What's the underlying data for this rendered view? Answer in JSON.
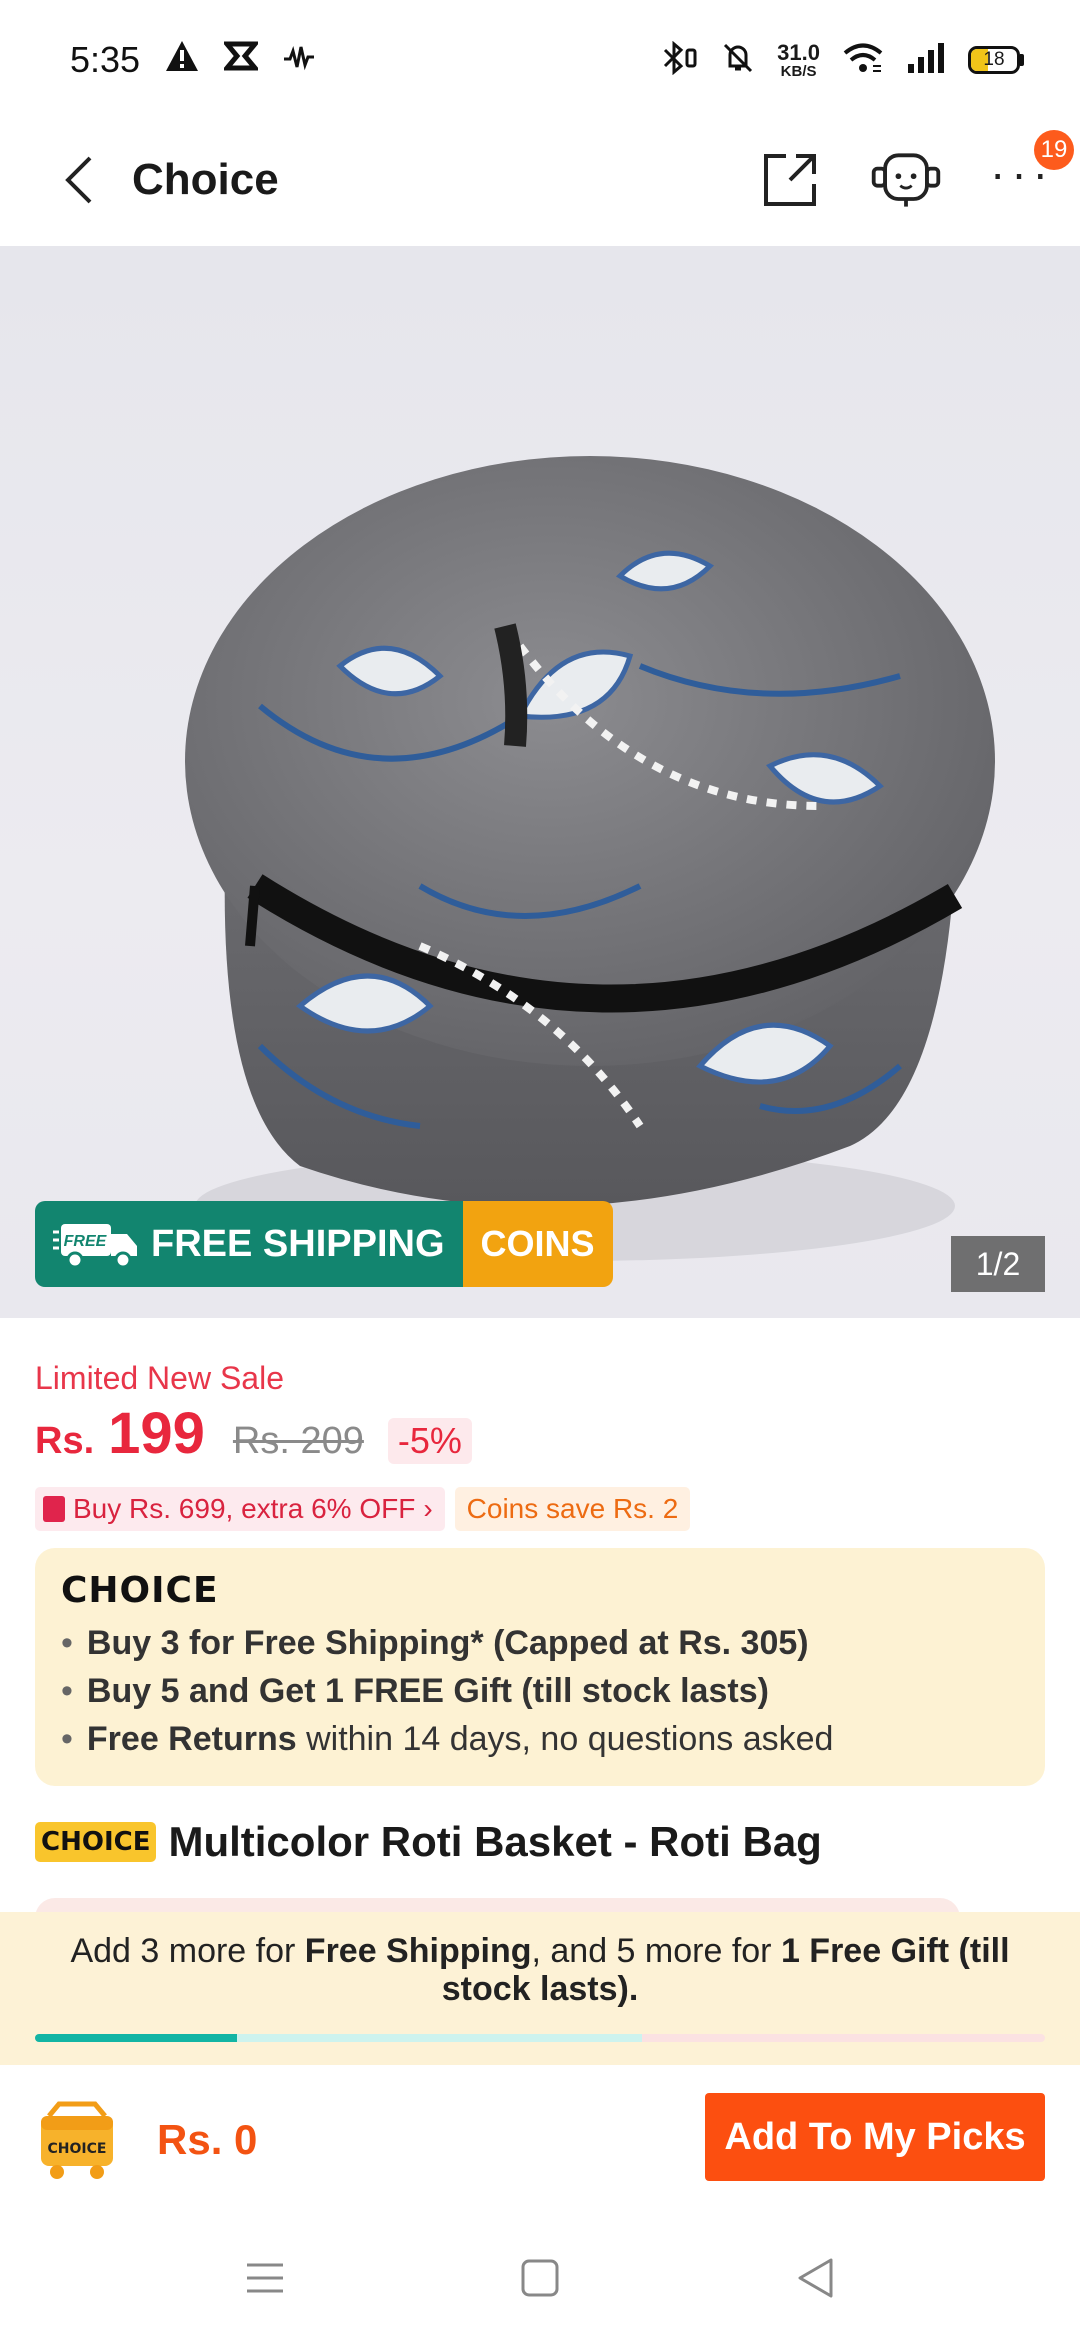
{
  "status_bar": {
    "time": "5:35",
    "net_speed_value": "31.0",
    "net_speed_unit": "KB/S",
    "battery_level": "18",
    "icons": [
      "alert-icon",
      "app-icon",
      "audio-icon",
      "bluetooth-icon",
      "mute-icon",
      "wifi-icon",
      "signal-icon",
      "battery-icon"
    ]
  },
  "header": {
    "title": "Choice",
    "cart_badge_count": "19",
    "more_label": "···"
  },
  "gallery": {
    "free_shipping_label": "FREE SHIPPING",
    "free_tag": "FREE",
    "coins_label": "COINS",
    "page_indicator": "1/2",
    "progress_fraction": 0.5,
    "colors": {
      "free_shipping": "#12856f",
      "coins": "#f2a310"
    }
  },
  "price": {
    "sale_label": "Limited New Sale",
    "currency": "Rs.",
    "current": "199",
    "original": "Rs. 209",
    "discount": "-5%",
    "offer_chip": "Buy Rs. 699, extra 6% OFF",
    "offer_chip_arrow": "›",
    "coins_chip": "Coins save Rs. 2",
    "colors": {
      "price": "#e8273d",
      "sale": "#e8364a"
    }
  },
  "choice_card": {
    "logo": "CHOICE",
    "items": [
      {
        "bold": "Buy 3 for  Free Shipping* (Capped at Rs. 305)",
        "rest": ""
      },
      {
        "bold": "Buy 5 and Get 1 FREE Gift (till stock lasts)",
        "rest": ""
      },
      {
        "bold": "Free Returns",
        "rest": " within 14 days, no questions asked"
      }
    ]
  },
  "product": {
    "badge": "CHOICE",
    "title": "Multicolor Roti Basket - Roti Bag"
  },
  "bundle_banner": {
    "part1": "Add 3 more for ",
    "part2": "Free Shipping",
    "part3": ", and 5 more for ",
    "part4": "1 Free Gift (till stock lasts).",
    "progress_fraction": 0.2
  },
  "bottom_bar": {
    "cart_icon_label": "CHOICE",
    "total": "Rs. 0",
    "add_button": "Add To My Picks",
    "accent_color": "#fc4f10"
  },
  "android_nav": {
    "icons": [
      "menu-icon",
      "home-icon",
      "back-triangle-icon"
    ]
  }
}
